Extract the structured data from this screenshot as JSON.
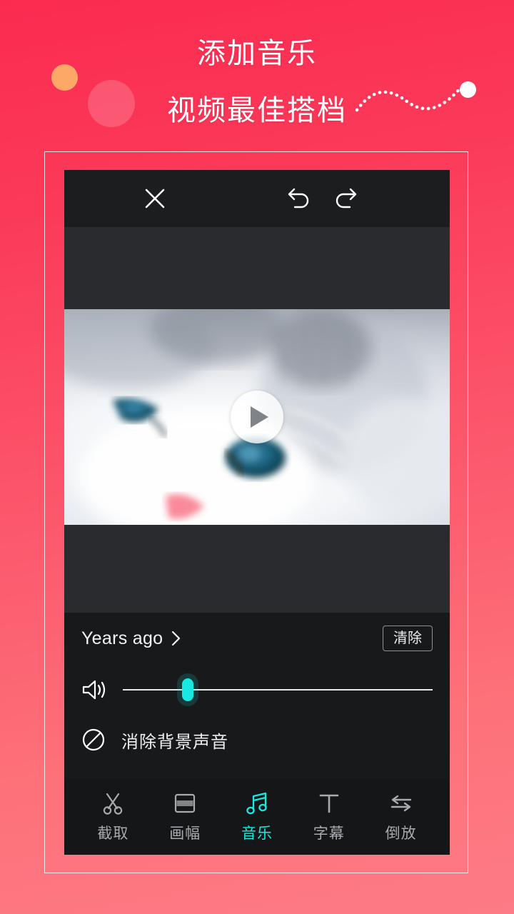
{
  "hero": {
    "title": "添加音乐",
    "subtitle": "视频最佳搭档"
  },
  "colors": {
    "background_top": "#fb2b50",
    "background_bottom": "#fd7b86",
    "accent_cyan": "#17e8e0",
    "panel_dark": "#18191b",
    "letterbox": "#2a2b2e",
    "deco_orange": "#fdb269"
  },
  "editor": {
    "topbar": {
      "close_icon": "close-icon",
      "undo_icon": "undo-icon",
      "redo_icon": "redo-icon",
      "confirm_icon": "check-icon"
    },
    "preview": {
      "play_icon": "play-icon",
      "media_description": "白色布偶猫特写"
    },
    "track": {
      "name": "Years ago",
      "chevron_icon": "chevron-right-icon",
      "clear_label": "清除"
    },
    "volume": {
      "icon": "speaker-icon",
      "value_percent": 21
    },
    "mute": {
      "icon": "prohibit-icon",
      "label": "消除背景声音"
    },
    "toolbar": {
      "active_index": 2,
      "items": [
        {
          "label": "截取",
          "icon": "scissors-icon"
        },
        {
          "label": "画幅",
          "icon": "crop-frame-icon"
        },
        {
          "label": "音乐",
          "icon": "music-note-icon"
        },
        {
          "label": "字幕",
          "icon": "text-t-icon"
        },
        {
          "label": "倒放",
          "icon": "reverse-arrows-icon"
        }
      ]
    }
  }
}
